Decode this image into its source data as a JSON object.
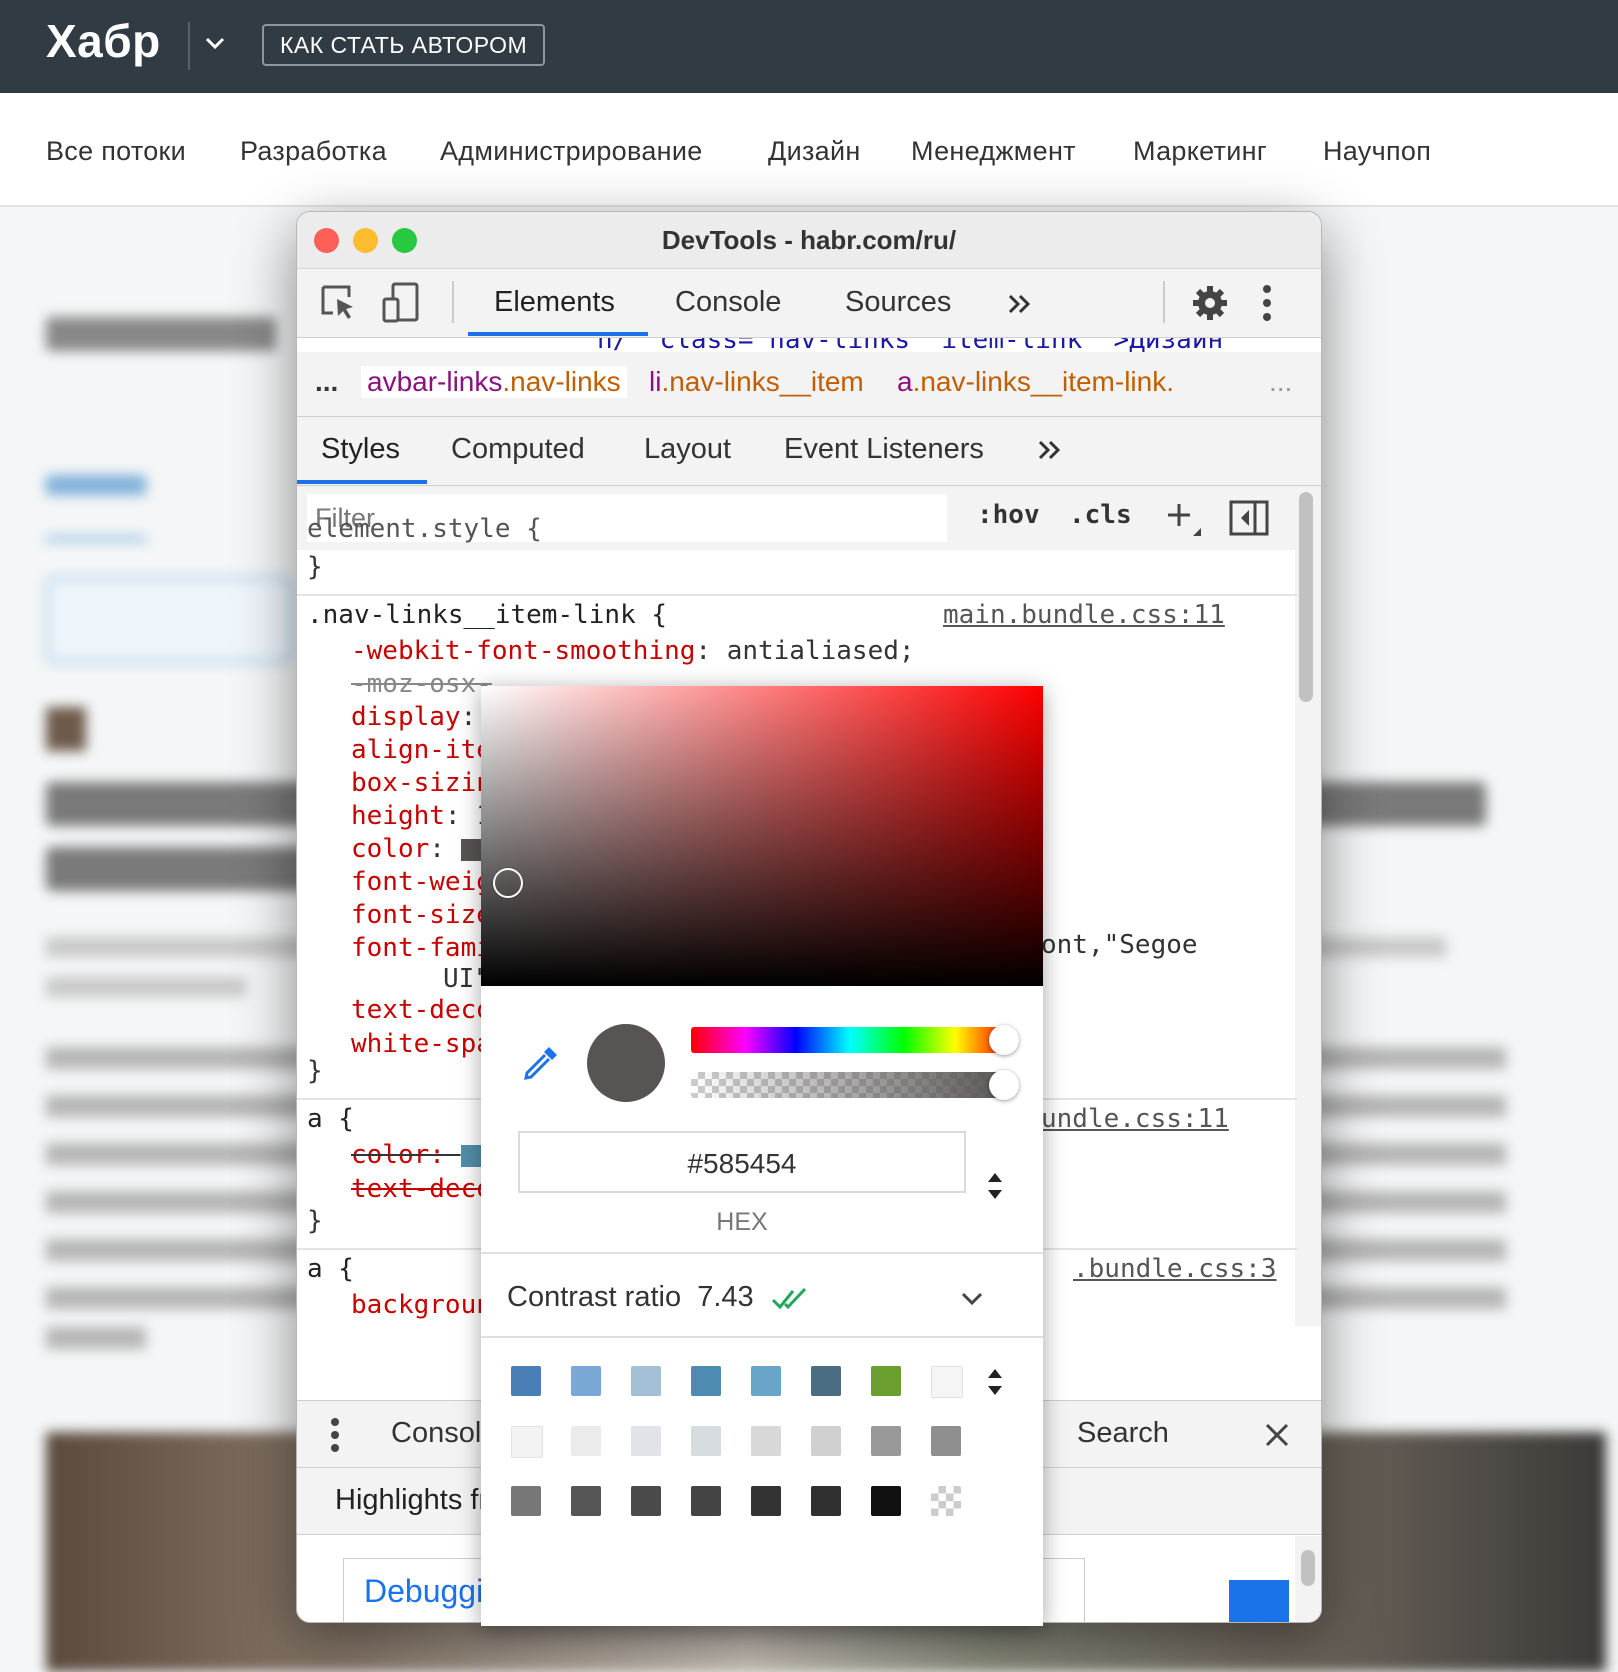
{
  "site": {
    "logo": "Хабр",
    "author_button": "КАК СТАТЬ АВТОРОМ",
    "nav": [
      "Все потоки",
      "Разработка",
      "Администрирование",
      "Дизайн",
      "Менеджмент",
      "Маркетинг",
      "Научпоп"
    ]
  },
  "devtools": {
    "title": "DevTools - habr.com/ru/",
    "main_tabs": [
      "Elements",
      "Console",
      "Sources"
    ],
    "dom_peek": "n/\" class=\"nav-links__item-link \">Дизайн",
    "breadcrumbs": {
      "ellipsis": "...",
      "items": [
        {
          "tag": "avbar-links",
          "cls": ".nav-links"
        },
        {
          "tag": "li",
          "cls": ".nav-links__item"
        },
        {
          "tag": "a",
          "cls": ".nav-links__item-link."
        }
      ],
      "trailing": "..."
    },
    "sub_tabs": [
      "Styles",
      "Computed",
      "Layout",
      "Event Listeners"
    ],
    "filter_placeholder": "Filter",
    "hov": ":hov",
    "cls": ".cls",
    "styles": {
      "element_style_open": "element.style {",
      "close": "}",
      "rule1_selector": ".nav-links__item-link {",
      "rule1_source": "main.bundle.css:11",
      "rule1_props": [
        {
          "name": "-webkit-font-smoothing",
          "sep": ": ",
          "value": "antialiased;"
        },
        {
          "name": "-moz-osx-",
          "sep": "",
          "value": ""
        },
        {
          "name": "display",
          "sep": ":",
          "value": ""
        },
        {
          "name": "align-ite",
          "sep": "",
          "value": ""
        },
        {
          "name": "box-sizin",
          "sep": "",
          "value": ""
        },
        {
          "name": "height",
          "sep": ": ",
          "value": "1"
        },
        {
          "name": "color",
          "sep": ": ",
          "value": ""
        },
        {
          "name": "font-weig",
          "sep": "",
          "value": ""
        },
        {
          "name": "font-size",
          "sep": "",
          "value": ""
        },
        {
          "name": "font-fami",
          "sep": "",
          "value": ""
        },
        {
          "name": "",
          "sep": "",
          "value": "UI\""
        },
        {
          "name": "text-deco",
          "sep": "",
          "value": ""
        },
        {
          "name": "white-spa",
          "sep": "",
          "value": ""
        }
      ],
      "font_family_tail": "ont,\"Segoe",
      "rule2_selector": "a {",
      "rule2_source": "undle.css:11",
      "rule2_props": [
        "color:",
        "text-deco"
      ],
      "rule3_selector": "a {",
      "rule3_source": ".bundle.css:3",
      "rule3_prop": "backgroun"
    },
    "drawer": {
      "console_tab": "Console",
      "search_tab": "Search",
      "highlights": "Highlights fr",
      "debug_link": "Debugging support for Trusted Type violations"
    }
  },
  "color_picker": {
    "hex_value": "#585454",
    "format_label": "HEX",
    "contrast_label": "Contrast ratio",
    "contrast_value": "7.43",
    "current_color": "#585454",
    "palette": [
      [
        "#4a7fb5",
        "#7aa8d6",
        "#a3c0d6",
        "#4d8bb0",
        "#6aa5c9",
        "#4a6d82",
        "#6a9e2e",
        "#f5f5f5"
      ],
      [
        "#f3f3f3",
        "#ebebeb",
        "#e0e4e8",
        "#d6dce0",
        "#d8d8d8",
        "#d0d0d0",
        "#999999",
        "#8f8f8f"
      ],
      [
        "#777777",
        "#555555",
        "#4a4a4a",
        "#444444",
        "#333333",
        "#303030",
        "#111111",
        "#transparent"
      ]
    ]
  }
}
